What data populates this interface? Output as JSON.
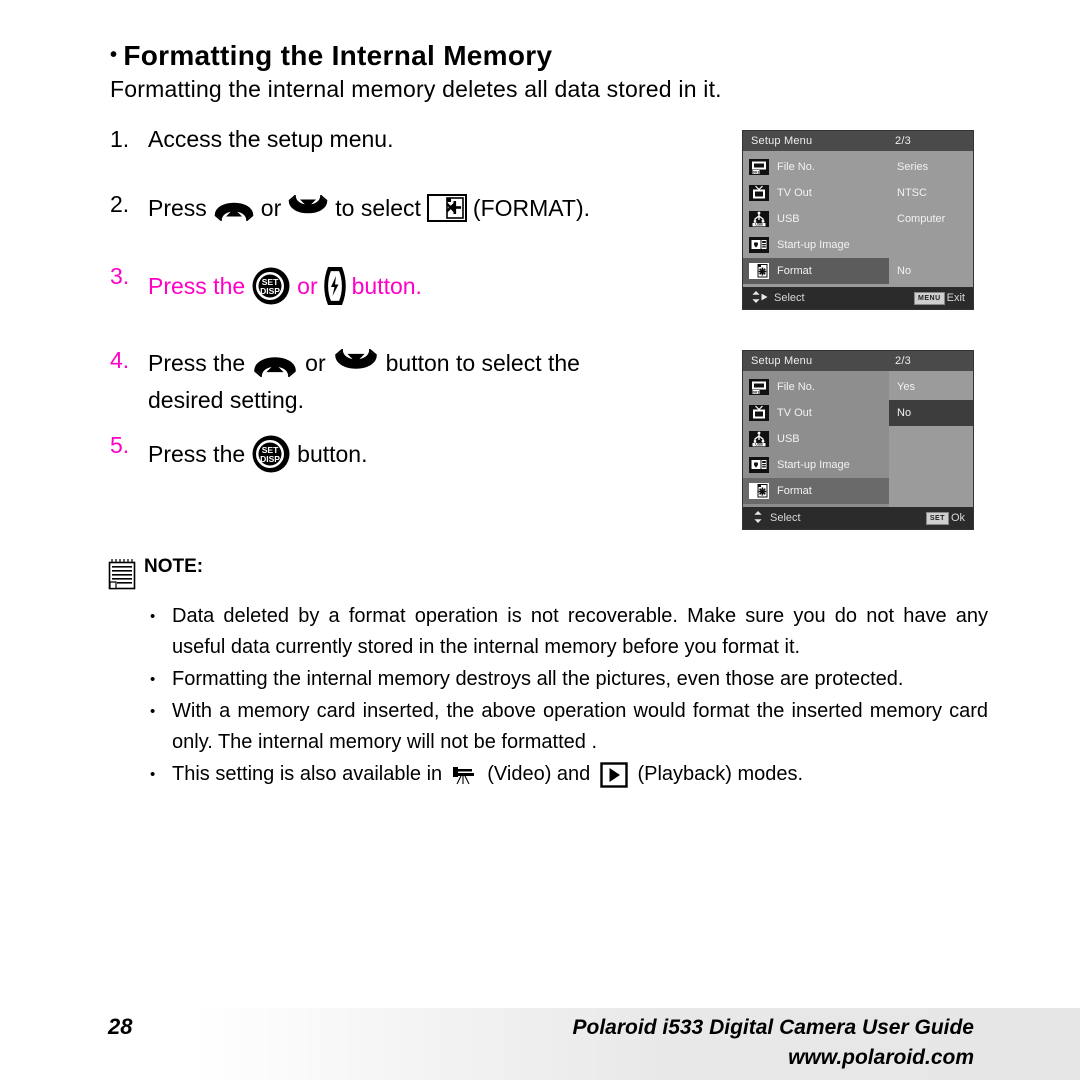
{
  "heading": {
    "bullet": "•",
    "title": "Formatting the Internal Memory",
    "subtitle": "Formatting the internal memory deletes all data stored in it."
  },
  "steps": [
    {
      "num": "1.",
      "text": "Access the setup menu."
    },
    {
      "num": "2.",
      "pre": "Press",
      "mid": "or",
      "post": "to select",
      "tail": "(FORMAT)."
    },
    {
      "num": "3.",
      "pre": "Press the",
      "mid": "or",
      "post": "button.",
      "color": "#ff00c8"
    },
    {
      "num": "4.",
      "pre": "Press the",
      "mid": "or",
      "post": "button to select the",
      "line2": "desired setting."
    },
    {
      "num": "5.",
      "pre": "Press the",
      "post": "button."
    }
  ],
  "lcd1": {
    "title": "Setup Menu",
    "page": "2/3",
    "rows": [
      {
        "icon": "file-no-icon",
        "label": "File No.",
        "value": "Series",
        "selected": false
      },
      {
        "icon": "tv-out-icon",
        "label": "TV Out",
        "value": "NTSC",
        "selected": false
      },
      {
        "icon": "usb-icon",
        "label": "USB",
        "value": "Computer",
        "selected": false
      },
      {
        "icon": "start-up-image-icon",
        "label": "Start-up Image",
        "value": "",
        "selected": false
      },
      {
        "icon": "format-icon",
        "label": "Format",
        "value": "No",
        "selected": true
      }
    ],
    "footer_left": "Select",
    "footer_right": "Exit",
    "footer_key": "MENU"
  },
  "lcd2": {
    "title": "Setup Menu",
    "page": "2/3",
    "rows": [
      {
        "icon": "file-no-icon",
        "label": "File No.",
        "selected": false
      },
      {
        "icon": "tv-out-icon",
        "label": "TV Out",
        "selected": false
      },
      {
        "icon": "usb-icon",
        "label": "USB",
        "selected": false
      },
      {
        "icon": "start-up-image-icon",
        "label": "Start-up Image",
        "selected": false
      },
      {
        "icon": "format-icon",
        "label": "Format",
        "selected": true
      }
    ],
    "options": [
      {
        "label": "Yes",
        "selected": false
      },
      {
        "label": "No",
        "selected": true
      }
    ],
    "footer_left": "Select",
    "footer_right": "Ok",
    "footer_key": "SET"
  },
  "note": {
    "title": "NOTE:",
    "bullets": [
      "Data deleted by a format operation is not recoverable. Make sure you do not have any useful data currently stored in the internal memory before you format it.",
      "Formatting the internal memory destroys all the pictures, even those are protected.",
      "With a memory card inserted, the above operation would format the inserted memory card only. The internal memory will not be formatted .",
      "This setting is also available in"
    ],
    "last_mid": "(Video) and",
    "last_end": "(Playback) modes."
  },
  "footer": {
    "page_number": "28",
    "guide": "Polaroid i533 Digital Camera User Guide",
    "website": "www.polaroid.com"
  },
  "colors": {
    "magenta": "#ff00c8",
    "lcd_bg": "#9b9b9b",
    "lcd_title_bg": "#4a4a4a",
    "lcd_footer_bg": "#2b2b2b",
    "lcd_selected": "#5c5c5c"
  }
}
